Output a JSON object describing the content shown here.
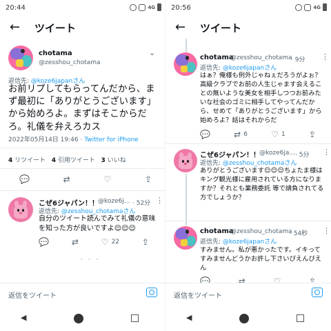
{
  "left": {
    "status": {
      "time": "20:44",
      "network": "4G"
    },
    "header": {
      "back_icon": "←",
      "title": "ツイート"
    },
    "main_tweet": {
      "name": "chotama",
      "handle": "@zesshou_chotama",
      "reply_to_label": "返信先: ",
      "reply_to_mention": "@koze6japanさん",
      "text": "お前リプしてもらってんだから、まず最初に「ありがとうございます」から始めろよ。まずはそこからだろ。礼儀を弁えろカス",
      "date": "2022年05月14日 19:46 · ",
      "source": "Twitter for iPhone",
      "stats": [
        {
          "count": "4",
          "label": "リツイート"
        },
        {
          "count": "4",
          "label": "引用ツイート"
        },
        {
          "count": "3",
          "label": "いいね"
        }
      ]
    },
    "reply_tweet": {
      "name": "こぜ6ジャパン！！",
      "handle": "@koze6j...",
      "time": "· 52分",
      "reply_to_label": "返信先: ",
      "reply_to_mention": "@zesshou_chotamaさん",
      "text": "自分のツイート読んでみて礼儀の意味を知った方が良いですよ😌😌😌",
      "likes": "22"
    },
    "compose_placeholder": "返信をツイート"
  },
  "right": {
    "status": {
      "time": "20:56",
      "network": "4G"
    },
    "header": {
      "back_icon": "←",
      "title": "ツイート"
    },
    "tweets": [
      {
        "name": "chotama",
        "handle": "@zesshou_chotama",
        "time": "· 9分",
        "reply_to_label": "返信先: ",
        "reply_to_mention": "@koze6japanさん",
        "text": "はぁ？俺様も例外じゃねぇだろうがよぉ？高級クラブでお前の人生じゃます会えることの無いような美女を相手しつつお前みたいな社会のゴミに相手してやってんだから、せめて「ありがとうございます」から始めろよ？話はそれからだ",
        "replies": "",
        "retweets": "6",
        "likes": "1"
      },
      {
        "name": "こぜ6ジャパン！！",
        "handle": "@koze6ja...",
        "time": "· 5分",
        "reply_to_label": "返信先: ",
        "reply_to_mention": "@zesshou_chotamaさん",
        "text": "ありがとうございます😌😌😌ちょたま様はキング観光様に雇用されている方になりますか？それとも業務委託 等で請負されてる方でしょうか？"
      },
      {
        "name": "chotama",
        "handle": "@zesshou_chotama",
        "time": "· 54秒",
        "reply_to_label": "返信先: ",
        "reply_to_mention": "@koze6japanさん",
        "text": "すみません。私が悪かったです。イキってすみませんどうかお許し下さいぴえんぴえん"
      }
    ],
    "compose_placeholder": "返信をツイート"
  }
}
